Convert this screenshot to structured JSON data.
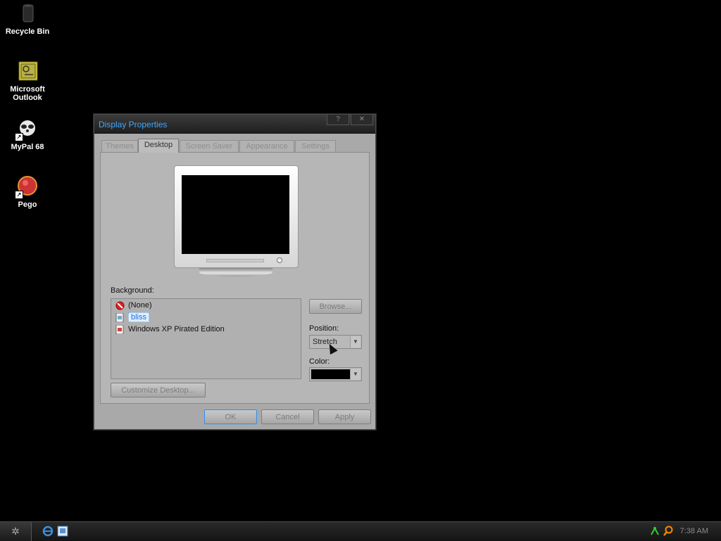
{
  "desktop": {
    "icons": [
      {
        "label": "Recycle Bin",
        "icon": "recycle-bin-icon"
      },
      {
        "label": "Microsoft\nOutlook",
        "icon": "outlook-icon"
      },
      {
        "label": "MyPal 68",
        "icon": "mypal-icon"
      },
      {
        "label": "Pego",
        "icon": "pego-icon"
      }
    ]
  },
  "window": {
    "title": "Display Properties",
    "help_button": "?",
    "close_button": "✕",
    "tabs": [
      "Themes",
      "Desktop",
      "Screen Saver",
      "Appearance",
      "Settings"
    ],
    "active_tab": "Desktop",
    "background_label": "Background:",
    "background_items": [
      "(None)",
      "bliss",
      "Windows XP Pirated Edition"
    ],
    "selected_background": "bliss",
    "browse_button": "Browse...",
    "position_label": "Position:",
    "position_value": "Stretch",
    "color_label": "Color:",
    "color_value": "#000000",
    "customize_button": "Customize Desktop...",
    "ok_button": "OK",
    "cancel_button": "Cancel",
    "apply_button": "Apply"
  },
  "taskbar": {
    "start_icon": "start-icon",
    "quick_launch": [
      "internet-explorer-icon",
      "outlook-express-icon"
    ],
    "tray": [
      "network-icon",
      "search-icon"
    ],
    "clock": "7:38 AM"
  }
}
